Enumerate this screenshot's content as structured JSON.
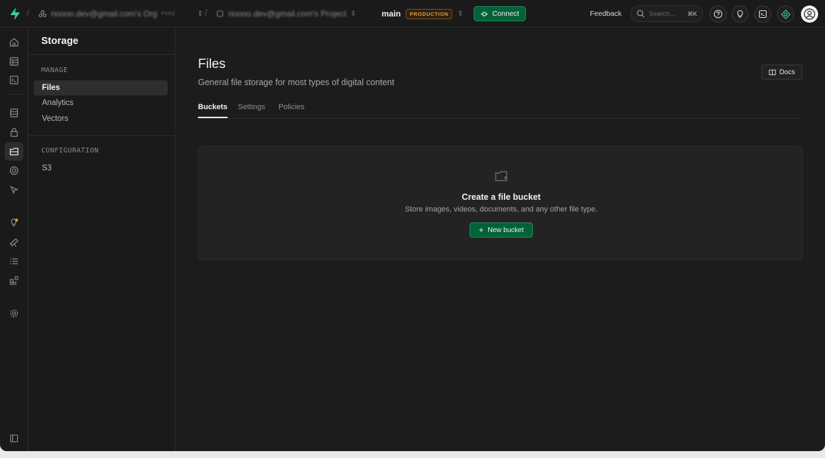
{
  "topbar": {
    "org_name": "rioooo.dev@gmail.com's Org",
    "org_badge": "FREE",
    "project_name": "rioooo.dev@gmail.com's Project",
    "branch_name": "main",
    "branch_badge": "PRODUCTION",
    "connect_label": "Connect",
    "feedback_label": "Feedback",
    "search_placeholder": "Search...",
    "search_shortcut": "⌘K"
  },
  "colors": {
    "accent": "#006239",
    "accent_border": "#2b8a5a",
    "production": "#e09a3e",
    "background": "#1c1c1c"
  },
  "rail": {
    "items": [
      "home-icon",
      "table-editor-icon",
      "sql-editor-icon",
      "database-icon",
      "auth-icon",
      "storage-icon",
      "realtime-icon",
      "edge-functions-icon",
      "advisors-icon",
      "reports-icon",
      "logs-icon",
      "integrations-icon",
      "settings-icon",
      "collapse-sidebar-icon"
    ],
    "active": "storage-icon"
  },
  "sidebar": {
    "title": "Storage",
    "sections": [
      {
        "heading": "MANAGE",
        "items": [
          "Files",
          "Analytics",
          "Vectors"
        ]
      },
      {
        "heading": "CONFIGURATION",
        "items": [
          "S3"
        ]
      }
    ],
    "active_item": "Files"
  },
  "main": {
    "title": "Files",
    "subtitle": "General file storage for most types of digital content",
    "docs_label": "Docs",
    "tabs": [
      "Buckets",
      "Settings",
      "Policies"
    ],
    "active_tab": "Buckets",
    "empty_state": {
      "title": "Create a file bucket",
      "description": "Store images, videos, documents, and any other file type.",
      "button_label": "New bucket"
    }
  }
}
